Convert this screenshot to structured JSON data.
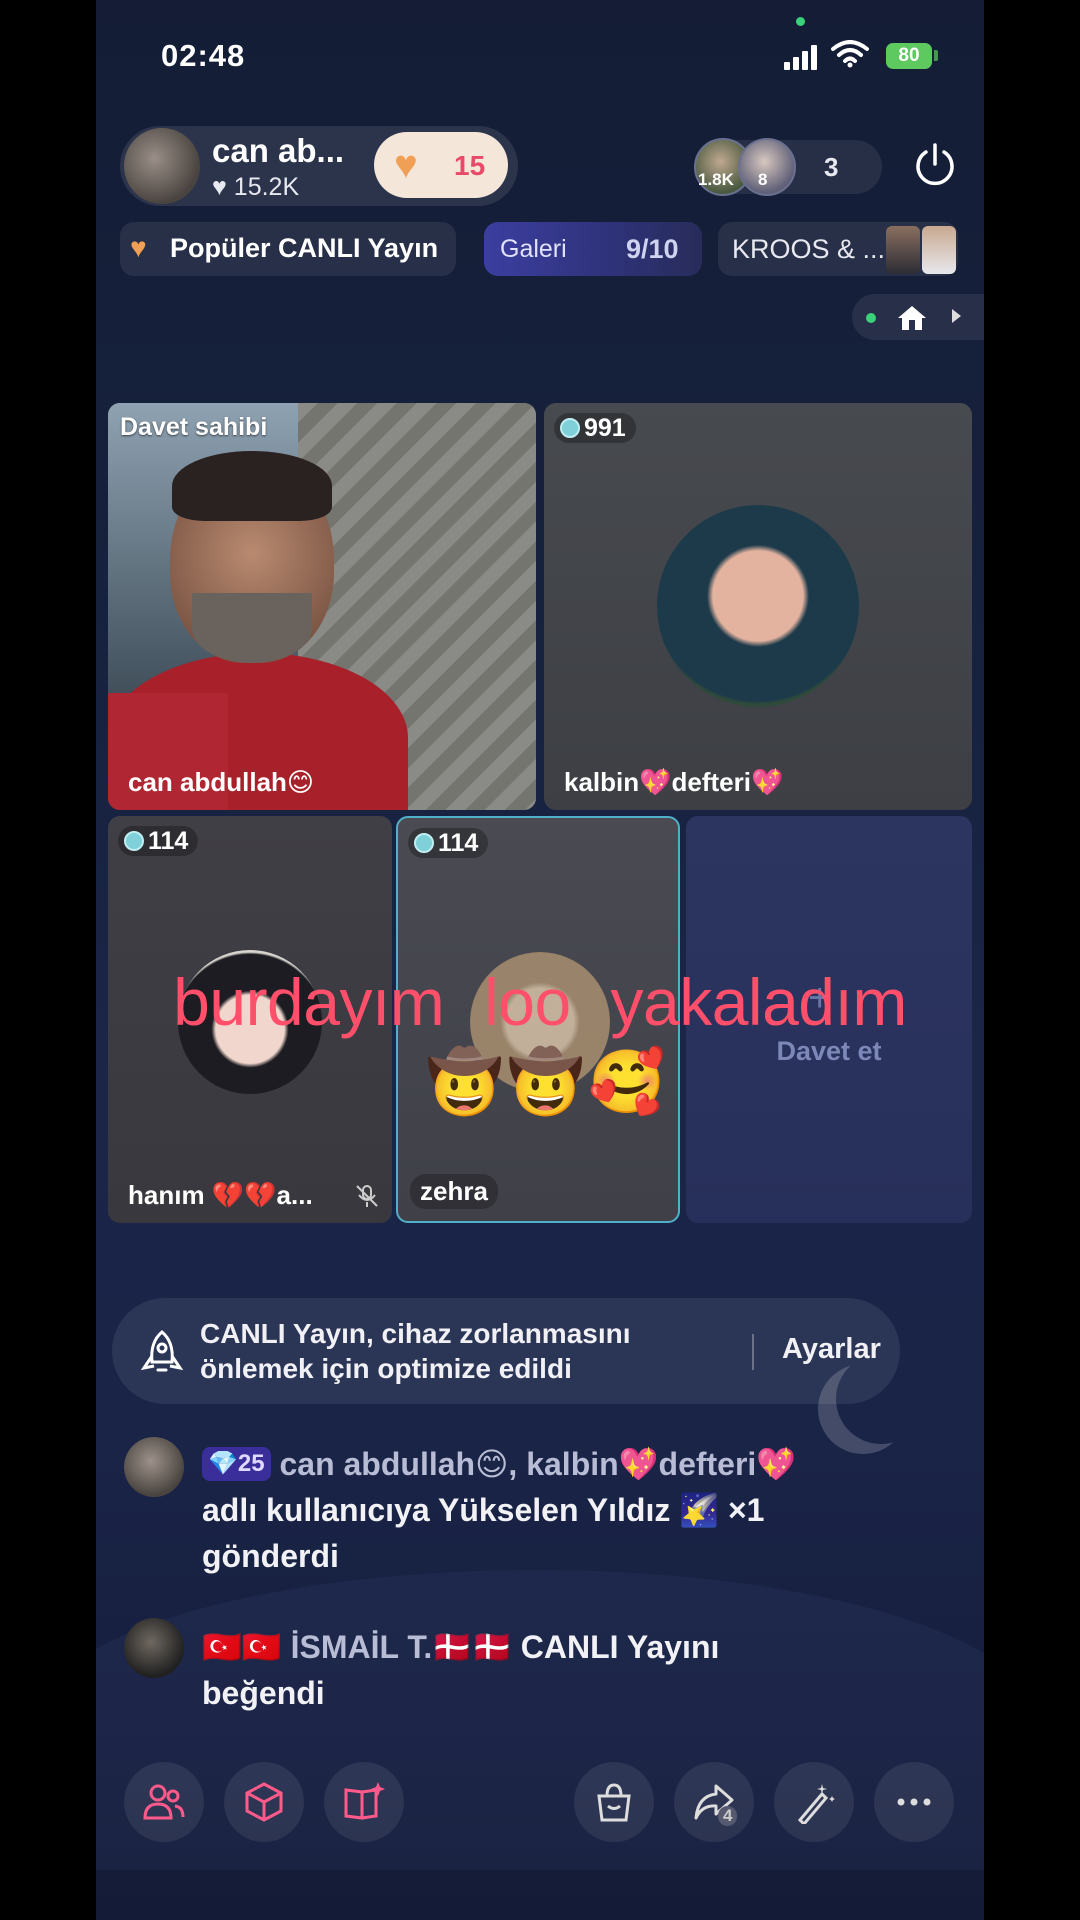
{
  "status_bar": {
    "time": "02:48",
    "battery": "80"
  },
  "host": {
    "name": "can ab...",
    "likes": "15.2K",
    "like_count": "15"
  },
  "viewers": {
    "avatar1_label": "1.8K",
    "avatar2_label": "8",
    "count": "3"
  },
  "tags": {
    "popular": "Popüler CANLI Yayın",
    "gallery_label": "Galeri",
    "gallery_count": "9/10",
    "kroos": "KROOS & ..."
  },
  "tiles": {
    "host_label": "Davet sahibi",
    "host_name": "can abdullah😊",
    "kalbin_badge": "991",
    "kalbin_name": "kalbin💖defteri💖",
    "hanim_badge": "114",
    "hanim_name": "hanım 💔💔a...",
    "zehra_badge": "114",
    "zehra_name": "zehra",
    "invite_label": "Davet et"
  },
  "overlay": {
    "text": "burdayım loo yakaladım",
    "emojis": "🤠🤠🥰"
  },
  "toast": {
    "line1": "CANLI Yayın, cihaz zorlanmasını",
    "line2": "önlemek için optimize edildi",
    "button": "Ayarlar"
  },
  "chat": [
    {
      "level": "💎25",
      "user": "can abdullah😊,",
      "text1": " kalbin💖defteri💖",
      "text2": "adlı kullanıcıya Yükselen Yıldız 🌠 ×1",
      "text3": "gönderdi"
    },
    {
      "user": "🇹🇷🇹🇷 İSMAİL T.🇩🇰🇩🇰",
      "text1": " CANLI Yayını",
      "text2": "beğendi"
    }
  ],
  "toolbar": {
    "share_count": "4"
  },
  "colors": {
    "accent_pink": "#ff4f6a",
    "battery": "#5ec95e",
    "like_pill": "#f4e6d8"
  }
}
